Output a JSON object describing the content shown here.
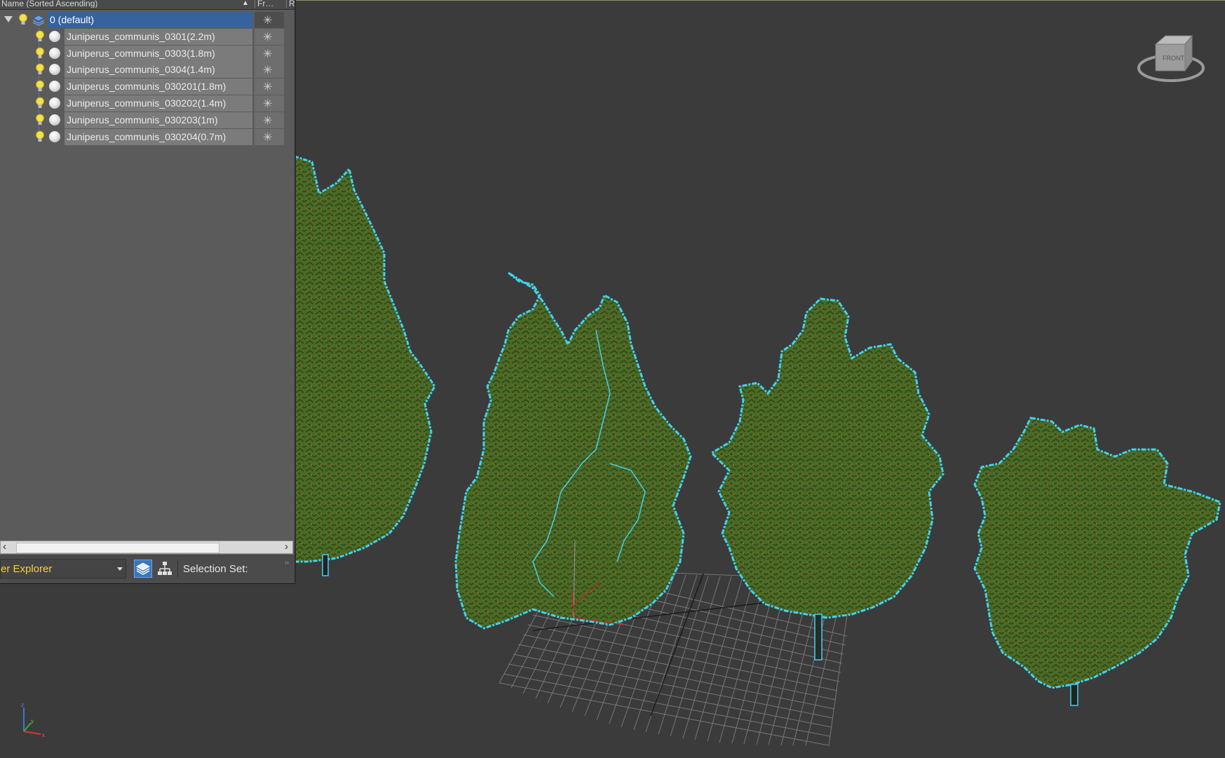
{
  "explorer": {
    "columns": {
      "name": "Name (Sorted Ascending)",
      "sort_indicator": "▲",
      "frozen": "Fr…",
      "render": "R"
    },
    "layer": {
      "label": "0 (default)"
    },
    "objects": [
      {
        "label": "Juniperus_communis_0301(2.2m)"
      },
      {
        "label": "Juniperus_communis_0303(1.8m)"
      },
      {
        "label": "Juniperus_communis_0304(1.4m)"
      },
      {
        "label": "Juniperus_communis_030201(1.8m)"
      },
      {
        "label": "Juniperus_communis_030202(1.4m)"
      },
      {
        "label": "Juniperus_communis_030203(1m)"
      },
      {
        "label": "Juniperus_communis_030204(0.7m)"
      }
    ],
    "freeze_glyph": "✳",
    "bottom": {
      "explorer_dropdown": "er Explorer",
      "selection_set_label": "Selection Set:"
    }
  },
  "viewport": {
    "viewcube_face": "FRONT",
    "colors": {
      "background": "#3b3b3b",
      "selection_outline": "#3fd3f0",
      "foliage": "#4e6b2a",
      "grid": "#8a8a8a"
    }
  },
  "icons": [
    "light-bulb-icon",
    "layer-stack-icon",
    "object-sphere-icon",
    "snowflake-icon",
    "hierarchy-icon",
    "expand-triangle-icon"
  ]
}
